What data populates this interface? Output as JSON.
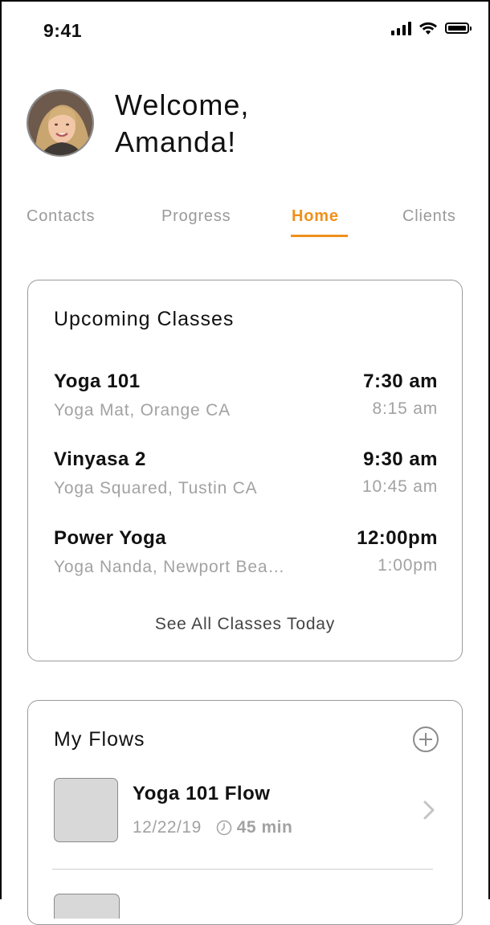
{
  "status_bar": {
    "time": "9:41"
  },
  "header": {
    "greeting_line1": "Welcome,",
    "greeting_line2": "Amanda!"
  },
  "tabs": [
    {
      "label": "Contacts",
      "active": false
    },
    {
      "label": "Progress",
      "active": false
    },
    {
      "label": "Home",
      "active": true
    },
    {
      "label": "Clients",
      "active": false
    }
  ],
  "upcoming": {
    "title": "Upcoming Classes",
    "classes": [
      {
        "name": "Yoga 101",
        "location": "Yoga Mat, Orange CA",
        "start": "7:30 am",
        "end": "8:15 am"
      },
      {
        "name": "Vinyasa 2",
        "location": "Yoga Squared, Tustin CA",
        "start": "9:30 am",
        "end": "10:45 am"
      },
      {
        "name": "Power Yoga",
        "location": "Yoga Nanda, Newport Bea…",
        "start": "12:00pm",
        "end": "1:00pm"
      }
    ],
    "see_all": "See All Classes Today"
  },
  "flows": {
    "title": "My Flows",
    "items": [
      {
        "name": "Yoga 101 Flow",
        "date": "12/22/19",
        "duration": "45 min"
      }
    ]
  },
  "colors": {
    "accent": "#f0901c",
    "muted_text": "#a2a2a2",
    "border": "#9a9a9a"
  },
  "icons": {
    "status": [
      "signal-icon",
      "wifi-icon",
      "battery-icon"
    ],
    "add": "plus-circle-icon",
    "clock": "clock-icon",
    "chevron": "chevron-right-icon"
  }
}
